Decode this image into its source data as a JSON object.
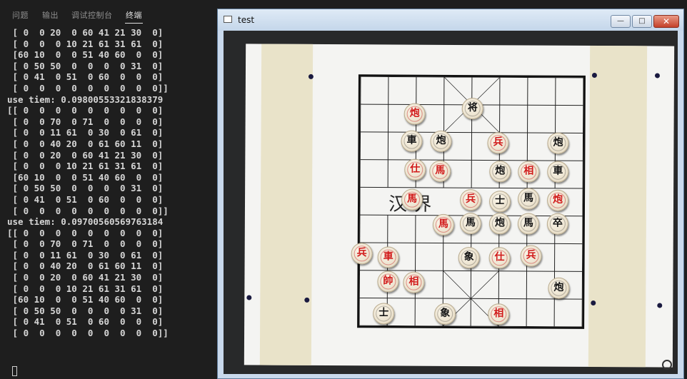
{
  "tabs": {
    "problems": "问题",
    "output": "输出",
    "debug_console": "调试控制台",
    "terminal": "终端"
  },
  "terminal": {
    "lines": [
      " [ 0  0 20  0 60 41 21 30  0]",
      " [ 0  0  0 10 21 61 31 61  0]",
      " [60 10  0  0 51 40 60  0  0]",
      " [ 0 50 50  0  0  0  0 31  0]",
      " [ 0 41  0 51  0 60  0  0  0]",
      " [ 0  0  0  0  0  0  0  0  0]]",
      "use tiem: 0.0980055332183837​9",
      "[[ 0  0  0  0  0  0  0  0  0]",
      " [ 0  0 70  0 71  0  0  0  0]",
      " [ 0  0 11 61  0 30  0 61  0]",
      " [ 0  0 40 20  0 61 60 11  0]",
      " [ 0  0 20  0 60 41 21 30  0]",
      " [ 0  0  0 10 21 61 31 61  0]",
      " [60 10  0  0 51 40 60  0  0]",
      " [ 0 50 50  0  0  0  0 31  0]",
      " [ 0 41  0 51  0 60  0  0  0]",
      " [ 0  0  0  0  0  0  0  0  0]]",
      "use tiem: 0.09700560569763184",
      "[[ 0  0  0  0  0  0  0  0  0]",
      " [ 0  0 70  0 71  0  0  0  0]",
      " [ 0  0 11 61  0 30  0 61  0]",
      " [ 0  0 40 20  0 61 60 11  0]",
      " [ 0  0 20  0 60 41 21 30  0]",
      " [ 0  0  0 10 21 61 31 61  0]",
      " [60 10  0  0 51 40 60  0  0]",
      " [ 0 50 50  0  0  0  0 31  0]",
      " [ 0 41  0 51  0 60  0  0  0]",
      " [ 0  0  0  0  0  0  0  0  0]]"
    ]
  },
  "window": {
    "title": "test",
    "minimize": "—",
    "maximize": "□",
    "close": "✕"
  },
  "board": {
    "river_left": "汉  界",
    "river_right": "",
    "pieces": [
      {
        "char": "炮",
        "side": "red"
      },
      {
        "char": "将",
        "side": "black"
      },
      {
        "char": "車",
        "side": "black"
      },
      {
        "char": "炮",
        "side": "black"
      },
      {
        "char": "兵",
        "side": "red"
      },
      {
        "char": "炮",
        "side": "black"
      },
      {
        "char": "仕",
        "side": "red"
      },
      {
        "char": "馬",
        "side": "red"
      },
      {
        "char": "炮",
        "side": "black"
      },
      {
        "char": "相",
        "side": "red"
      },
      {
        "char": "車",
        "side": "black"
      },
      {
        "char": "馬",
        "side": "red"
      },
      {
        "char": "兵",
        "side": "red"
      },
      {
        "char": "士",
        "side": "black"
      },
      {
        "char": "馬",
        "side": "black"
      },
      {
        "char": "炮",
        "side": "red"
      },
      {
        "char": "馬",
        "side": "red"
      },
      {
        "char": "馬",
        "side": "black"
      },
      {
        "char": "炮",
        "side": "black"
      },
      {
        "char": "馬",
        "side": "black"
      },
      {
        "char": "卒",
        "side": "black"
      },
      {
        "char": "兵",
        "side": "red"
      },
      {
        "char": "車",
        "side": "red"
      },
      {
        "char": "象",
        "side": "black"
      },
      {
        "char": "仕",
        "side": "red"
      },
      {
        "char": "兵",
        "side": "red"
      },
      {
        "char": "帥",
        "side": "red"
      },
      {
        "char": "相",
        "side": "red"
      },
      {
        "char": "炮",
        "side": "black"
      },
      {
        "char": "士",
        "side": "black"
      },
      {
        "char": "象",
        "side": "black"
      },
      {
        "char": "相",
        "side": "red"
      }
    ]
  }
}
